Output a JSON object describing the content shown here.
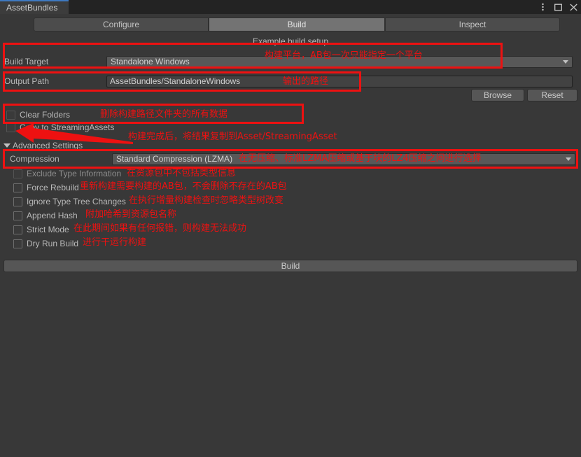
{
  "window": {
    "tab_title": "AssetBundles",
    "controls": [
      {
        "name": "menu-kebab",
        "glyph": "⋮"
      },
      {
        "name": "maximize",
        "glyph": "□"
      },
      {
        "name": "close",
        "glyph": "✕"
      }
    ]
  },
  "toolbar": {
    "tabs": [
      {
        "label": "Configure",
        "active": false
      },
      {
        "label": "Build",
        "active": true
      },
      {
        "label": "Inspect",
        "active": false
      }
    ]
  },
  "build": {
    "caption": "Example build setup",
    "build_target": {
      "label": "Build Target",
      "value": "Standalone Windows"
    },
    "output_path": {
      "label": "Output Path",
      "value": "AssetBundles/StandaloneWindows"
    },
    "browse_button": "Browse",
    "reset_button": "Reset",
    "clear_folders": {
      "label": "Clear Folders",
      "checked": false
    },
    "copy_to_streaming": {
      "label": "Copy to StreamingAssets",
      "checked": false
    },
    "advanced_settings": {
      "label": "Advanced Settings",
      "expanded": true
    },
    "compression": {
      "label": "Compression",
      "value": "Standard Compression (LZMA)"
    },
    "options": [
      {
        "label": "Exclude Type Information",
        "checked": false
      },
      {
        "label": "Force Rebuild",
        "checked": false
      },
      {
        "label": "Ignore Type Tree Changes",
        "checked": false
      },
      {
        "label": "Append Hash",
        "checked": false
      },
      {
        "label": "Strict Mode",
        "checked": false
      },
      {
        "label": "Dry Run Build",
        "checked": false
      }
    ],
    "build_button": "Build"
  },
  "annotations": {
    "color": "#ee1111",
    "build_target_note": "构建平台，AB包一次只能指定一个平台",
    "output_path_note": "输出的路径",
    "clear_folders_note": "删除构建路径文件夹的所有数据",
    "copy_streaming_note": "构建完成后，将结果复制到Asset/StreamingAsset",
    "compression_note": "在无压缩、标准LZMA压缩或基于块的LZ4压缩之间进行选择",
    "exclude_type_note": "在资源包中不包括类型信息",
    "force_rebuild_note": "重新构建需要构建的AB包，不会删除不存在的AB包",
    "ignore_type_tree_note": "在执行增量构建检查时忽略类型树改变",
    "append_hash_note": "附加哈希到资源包名称",
    "strict_mode_note": "在此期间如果有任何报错，则构建无法成功",
    "dry_run_note": "进行干运行构建"
  }
}
